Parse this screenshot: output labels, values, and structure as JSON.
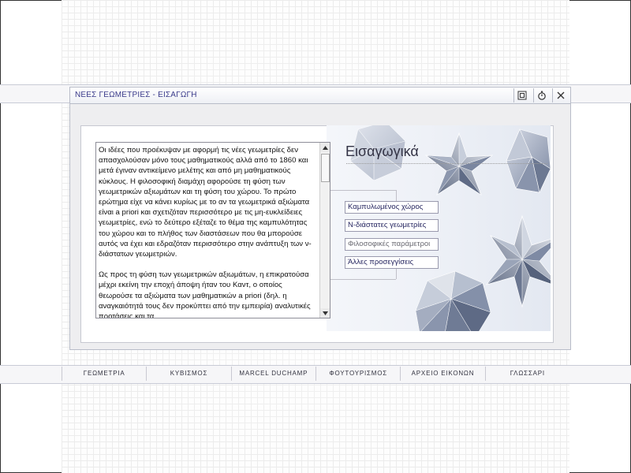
{
  "window": {
    "title": "ΝΕΕΣ ΓΕΩΜΕΤΡΙΕΣ - ΕΙΣΑΓΩΓΗ",
    "buttons": [
      {
        "name": "window-frame-button",
        "icon": "frame-icon"
      },
      {
        "name": "timer-button",
        "icon": "stopwatch-icon"
      },
      {
        "name": "close-button",
        "icon": "close-icon"
      }
    ]
  },
  "section": {
    "title": "Εισαγωγικά"
  },
  "intro_text": {
    "paragraphs": [
      "Οι ιδέες που προέκυψαν με αφορμή τις νέες γεωμετρίες δεν απασχολούσαν μόνο τους μαθηματικούς αλλά από το 1860 και μετά έγιναν αντικείμενο μελέτης και από μη μαθηματικούς κύκλους. Η φιλοσοφική διαμάχη αφορούσε τη φύση των γεωμετρικών αξιωμάτων και τη φύση του χώρου. Το πρώτο ερώτημα είχε να κάνει κυρίως με το αν τα γεωμετρικά αξιώματα είναι a priori και σχετιζόταν περισσότερο με τις μη-ευκλείδειες γεωμετρίες, ενώ το δεύτερο εξέταζε το θέμα της καμπυλότητας του χώρου και το πλήθος των διαστάσεων που θα μπορούσε αυτός να έχει και εδραζόταν περισσότερο στην ανάπτυξη των ν-διάστατων γεωμετριών.",
      "Ως προς τη φύση των γεωμετρικών αξιωμάτων, η επικρατούσα μέχρι εκείνη την εποχή άποψη ήταν του Καντ, ο οποίος θεωρούσε τα αξιώματα των μαθηματικών a priori (δηλ. η αναγκαιότητά τους δεν προκύπτει από την εμπειρία) αναλυτικές προτάσεις και τα"
    ]
  },
  "submenu": [
    {
      "label": "Καμπυλωμένος χώρος",
      "enabled": true
    },
    {
      "label": "Ν-διάστατες γεωμετρίες",
      "enabled": true
    },
    {
      "label": "Φιλοσοφικές παράμετροι",
      "enabled": false
    },
    {
      "label": "Άλλες προσεγγίσεις",
      "enabled": true
    }
  ],
  "nav": [
    {
      "label": "ΓΕΩΜΕΤΡΙΑ"
    },
    {
      "label": "ΚΥΒΙΣΜΟΣ"
    },
    {
      "label": "MARCEL DUCHAMP"
    },
    {
      "label": "ΦΟΥΤΟΥΡΙΣΜΟΣ"
    },
    {
      "label": "ΑΡΧΕΙΟ ΕΙΚΟΝΩΝ"
    },
    {
      "label": "ΓΛΩΣΣΑΡΙ"
    }
  ],
  "colors": {
    "accent": "#3a3a8a",
    "polyhedra": "#8894ad"
  }
}
